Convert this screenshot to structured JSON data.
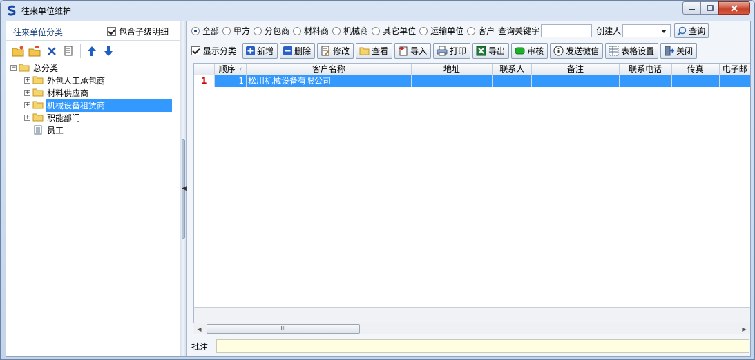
{
  "window": {
    "title": "往来单位维护"
  },
  "left": {
    "header": "往来单位分类",
    "include_sub": {
      "label": "包含子级明细",
      "checked": true
    },
    "tree": {
      "root": "总分类",
      "children": [
        "外包人工承包商",
        "材料供应商",
        "机械设备租赁商",
        "职能部门",
        "员工"
      ],
      "selected": "机械设备租赁商"
    }
  },
  "filter": {
    "options": [
      "全部",
      "甲方",
      "分包商",
      "材料商",
      "机械商",
      "其它单位",
      "运输单位",
      "客户"
    ],
    "selected": "全部",
    "keyword_label": "查询关键字",
    "keyword_value": "",
    "creator_label": "创建人",
    "creator_value": "",
    "query_label": "查询"
  },
  "toolbar": {
    "show_category": {
      "label": "显示分类",
      "checked": true
    },
    "add": "新增",
    "delete": "删除",
    "edit": "修改",
    "view": "查看",
    "import": "导入",
    "print": "打印",
    "export": "导出",
    "audit": "审核",
    "wechat": "发送微信",
    "table_settings": "表格设置",
    "close": "关闭"
  },
  "grid": {
    "columns": [
      "顺序",
      "客户名称",
      "地址",
      "联系人",
      "备注",
      "联系电话",
      "传真",
      "电子邮"
    ],
    "rows": [
      {
        "rownum": "1",
        "order": "1",
        "name": "松川机械设备有限公司",
        "address": "",
        "contact": "",
        "remark": "",
        "phone": "",
        "fax": "",
        "email": ""
      }
    ],
    "scroll_thumb": "III"
  },
  "note": {
    "label": "批注",
    "value": ""
  },
  "colors": {
    "selection": "#3399ff",
    "accent": "#1a3f7a"
  }
}
